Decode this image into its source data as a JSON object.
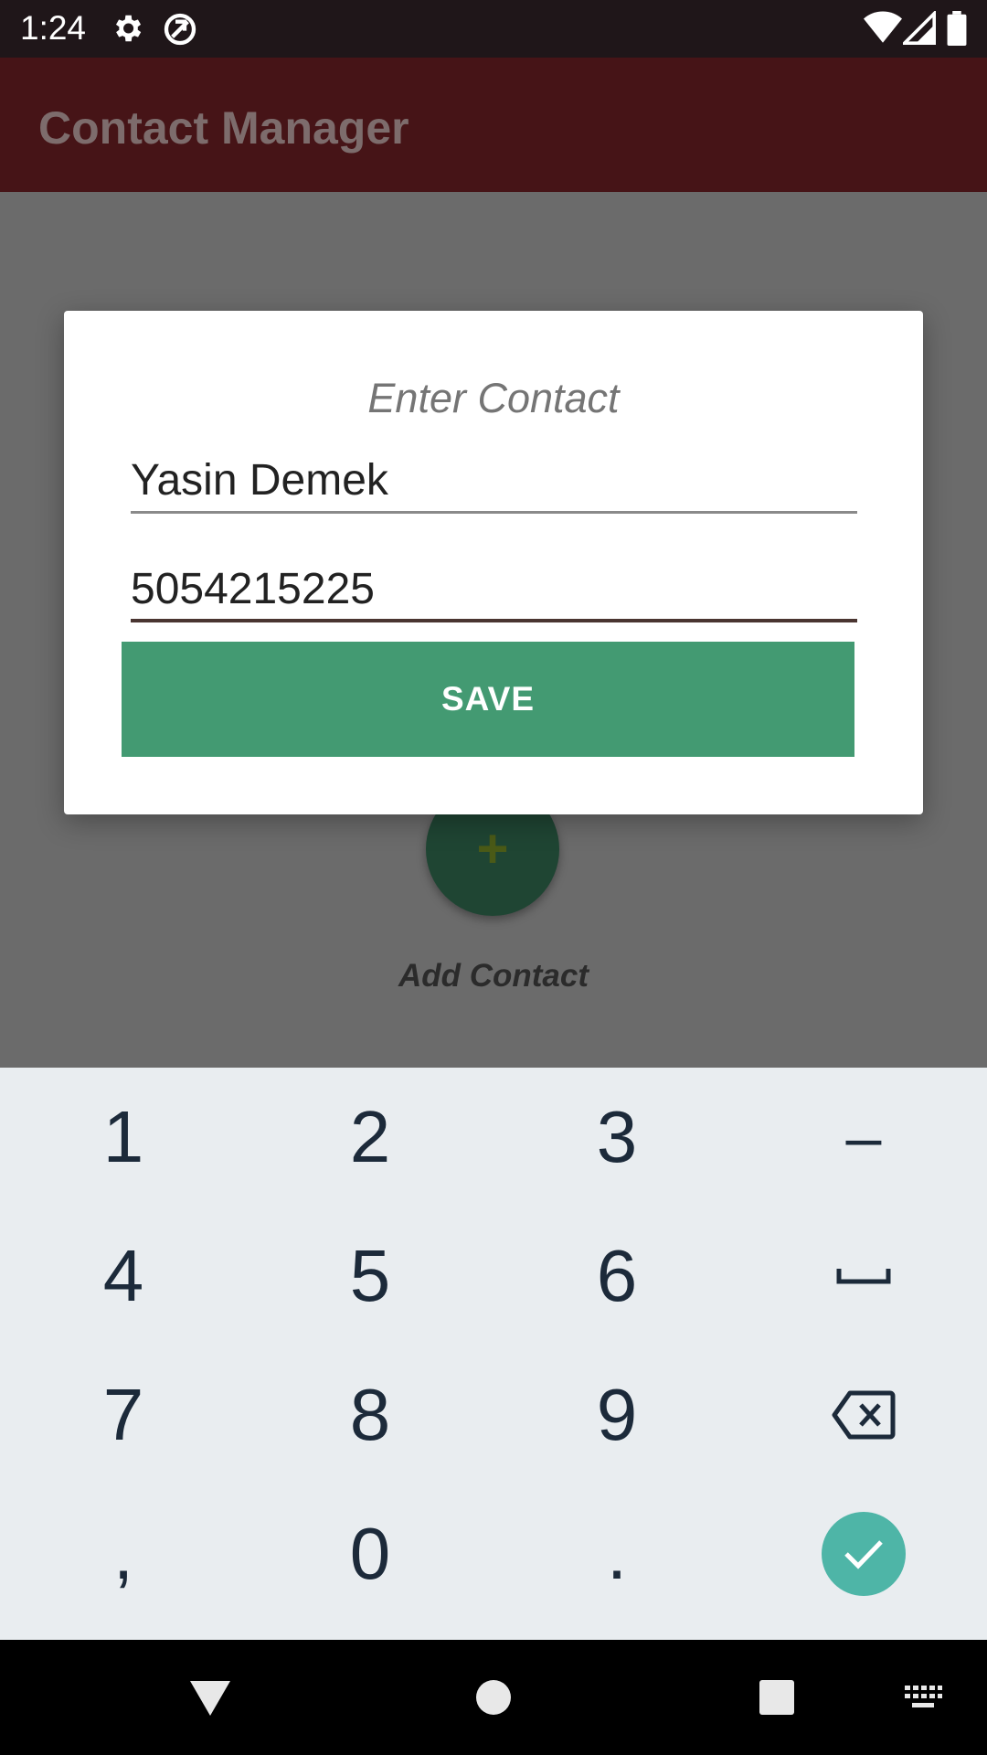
{
  "status_bar": {
    "time": "1:24",
    "icons": [
      "gear-icon",
      "sync-off-icon",
      "wifi-icon",
      "signal-icon",
      "battery-icon"
    ]
  },
  "app_bar": {
    "title": "Contact Manager"
  },
  "background": {
    "fab_symbol": "+",
    "fab_label": "Add Contact"
  },
  "dialog": {
    "title": "Enter Contact",
    "name_value": "Yasin Demek",
    "phone_value": "5054215225",
    "save_label": "SAVE"
  },
  "keyboard": {
    "rows": [
      [
        "1",
        "2",
        "3",
        "–"
      ],
      [
        "4",
        "5",
        "6",
        "space-icon"
      ],
      [
        "7",
        "8",
        "9",
        "backspace-icon"
      ],
      [
        ",",
        "0",
        ".",
        "done-check-icon"
      ]
    ]
  },
  "nav_bar": {
    "icons": [
      "back-icon",
      "home-icon",
      "recents-icon",
      "keyboard-switch-icon"
    ]
  },
  "colors": {
    "app_bar": "#461417",
    "save_button": "#439a72",
    "fab": "#1f4533",
    "keyboard_bg": "#e9edf0",
    "enter_key": "#4eb5a7"
  }
}
